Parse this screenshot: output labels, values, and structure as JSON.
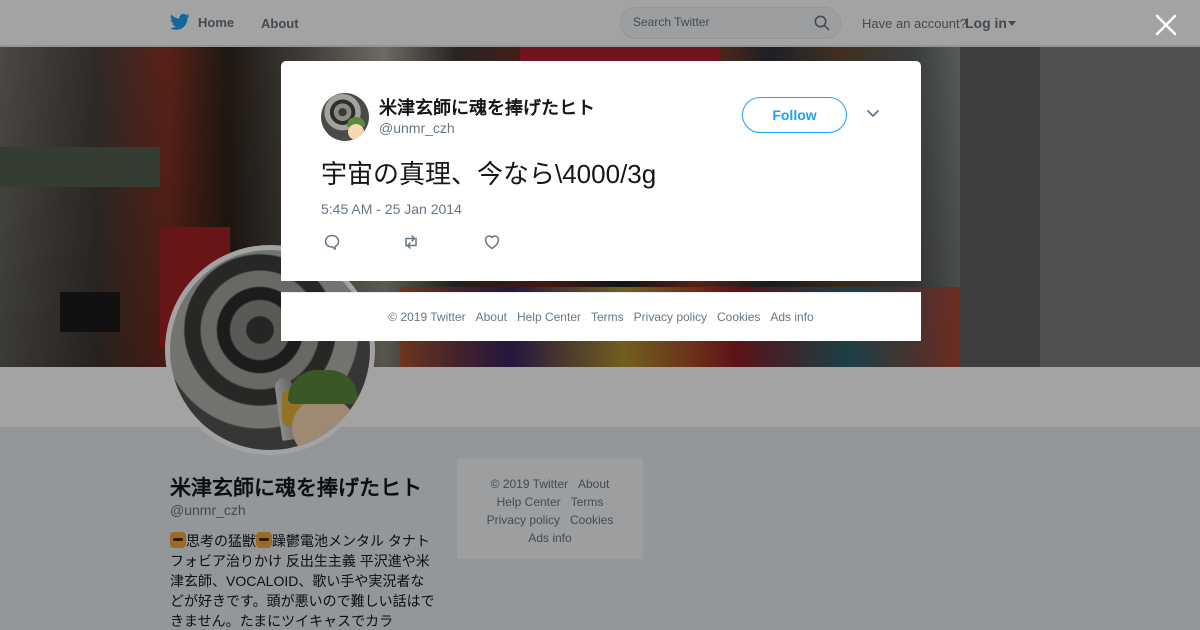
{
  "nav": {
    "home_label": "Home",
    "about_label": "About",
    "search_placeholder": "Search Twitter",
    "have_account": "Have an account?",
    "login_label": "Log in"
  },
  "profile": {
    "name": "米津玄師に魂を捧げたヒト",
    "handle": "@unmr_czh",
    "bio_part1": "思考の猛獣",
    "bio_part2": "躁鬱電池メンタル タナトフォビア治りかけ 反出生主義 平沢進や米津玄師、VOCALOID、歌い手や実況者などが好きです。頭が悪いので難しい話はできません。たまにツイキャスでカラ"
  },
  "side_footer": {
    "links": [
      "© 2019 Twitter",
      "About",
      "Help Center",
      "Terms",
      "Privacy policy",
      "Cookies",
      "Ads info"
    ]
  },
  "tweet": {
    "author_name": "米津玄師に魂を捧げたヒト",
    "author_handle": "@unmr_czh",
    "follow_label": "Follow",
    "text": "宇宙の真理、今なら\\4000/3g",
    "timestamp": "5:45 AM - 25 Jan 2014"
  },
  "modal_footer": {
    "links": [
      "© 2019 Twitter",
      "About",
      "Help Center",
      "Terms",
      "Privacy policy",
      "Cookies",
      "Ads info"
    ]
  },
  "colors": {
    "brand_blue": "#1da1f2",
    "secondary_text": "#657786",
    "overlay": "rgba(0,0,0,0.36)"
  },
  "icons": {
    "logo": "twitter-bird-icon",
    "search": "search-icon",
    "close": "close-icon",
    "caret": "chevron-down-icon",
    "reply": "reply-icon",
    "retweet": "retweet-icon",
    "like": "heart-icon"
  }
}
